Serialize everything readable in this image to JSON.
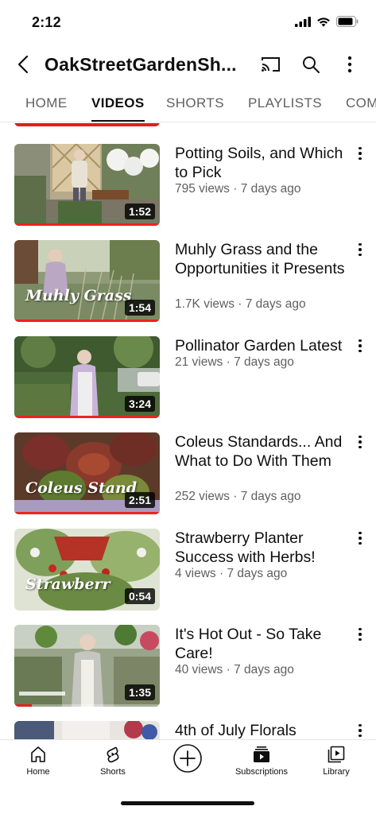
{
  "status_bar": {
    "time": "2:12"
  },
  "header": {
    "channel_name": "OakStreetGardenSh..."
  },
  "tabs": [
    {
      "label": "HOME",
      "active": false
    },
    {
      "label": "VIDEOS",
      "active": true
    },
    {
      "label": "SHORTS",
      "active": false
    },
    {
      "label": "PLAYLISTS",
      "active": false
    },
    {
      "label": "COMMUNITY",
      "active": false
    }
  ],
  "videos": [
    {
      "title": "Potting Soils, and Which to Pick",
      "views": "795 views · 7 days ago",
      "duration": "1:52",
      "thumb_text": "",
      "watched_fraction": 1.0
    },
    {
      "title": "Muhly Grass and the Opportunities it Presents",
      "views": "1.7K views · 7 days ago",
      "duration": "1:54",
      "thumb_text": "Muhly Grass",
      "watched_fraction": 1.0
    },
    {
      "title": "Pollinator Garden Latest",
      "views": "21 views · 7 days ago",
      "duration": "3:24",
      "thumb_text": "",
      "watched_fraction": 1.0
    },
    {
      "title": "Coleus Standards... And What to Do With Them",
      "views": "252 views · 7 days ago",
      "duration": "2:51",
      "thumb_text": "Coleus Stand",
      "watched_fraction": 1.0
    },
    {
      "title": "Strawberry Planter Success with Herbs!",
      "views": "4 views · 7 days ago",
      "duration": "0:54",
      "thumb_text": "Strawberr",
      "watched_fraction": 0
    },
    {
      "title": "It's Hot Out - So Take Care!",
      "views": "40 views · 7 days ago",
      "duration": "1:35",
      "thumb_text": "",
      "watched_fraction": 0.12
    },
    {
      "title": "4th of July Florals",
      "views": "",
      "duration": "",
      "thumb_text": "",
      "watched_fraction": 0
    }
  ],
  "bottom_nav": {
    "home": "Home",
    "shorts": "Shorts",
    "create": "",
    "subscriptions": "Subscriptions",
    "library": "Library"
  },
  "colors": {
    "progress": "#e62117",
    "text_primary": "#0f0f0f",
    "text_secondary": "#606060"
  }
}
